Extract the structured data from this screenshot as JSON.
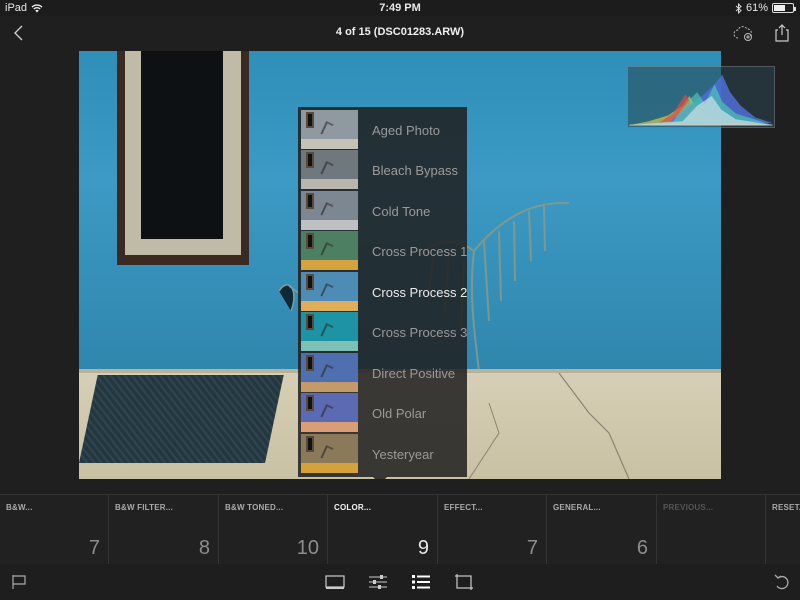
{
  "status_bar": {
    "device": "iPad",
    "time": "7:49 PM",
    "battery": "61%",
    "battery_level": 0.61
  },
  "nav": {
    "title": "4 of 15 (DSC01283.ARW)"
  },
  "presets": [
    {
      "label": "Aged Photo",
      "wall": "#8f9aa0",
      "ground": "#c5c2b8",
      "selected": false
    },
    {
      "label": "Bleach Bypass",
      "wall": "#6f787c",
      "ground": "#b9b6ad",
      "selected": false
    },
    {
      "label": "Cold Tone",
      "wall": "#7d8791",
      "ground": "#bfc0c4",
      "selected": false
    },
    {
      "label": "Cross Process 1",
      "wall": "#4d7f63",
      "ground": "#d6a23f",
      "selected": false
    },
    {
      "label": "Cross Process 2",
      "wall": "#4d8db5",
      "ground": "#e0ae5a",
      "selected": true
    },
    {
      "label": "Cross Process 3",
      "wall": "#1c94a5",
      "ground": "#7fc0b5",
      "selected": false
    },
    {
      "label": "Direct Positive",
      "wall": "#4f6fb0",
      "ground": "#c59a6a",
      "selected": false
    },
    {
      "label": "Old Polar",
      "wall": "#5c6ab4",
      "ground": "#d99d77",
      "selected": false
    },
    {
      "label": "Yesteryear",
      "wall": "#8a7a5a",
      "ground": "#d3a23c",
      "selected": false
    }
  ],
  "groups": [
    {
      "name": "B&W...",
      "count": "7",
      "state": "normal"
    },
    {
      "name": "B&W FILTER...",
      "count": "8",
      "state": "normal"
    },
    {
      "name": "B&W TONED...",
      "count": "10",
      "state": "normal"
    },
    {
      "name": "COLOR...",
      "count": "9",
      "state": "active"
    },
    {
      "name": "EFFECT...",
      "count": "7",
      "state": "normal"
    },
    {
      "name": "GENERAL...",
      "count": "6",
      "state": "normal"
    },
    {
      "name": "PREVIOUS...",
      "count": "",
      "state": "disabled"
    },
    {
      "name": "RESET...",
      "count": "",
      "state": "normal"
    }
  ],
  "icons": {
    "back": "chevron-left-icon",
    "cloud": "cloud-sync-icon",
    "share": "share-icon",
    "flag": "flag-icon",
    "filmstrip": "filmstrip-icon",
    "adjust": "sliders-icon",
    "presets": "presets-list-icon",
    "crop": "crop-icon",
    "undo": "undo-icon"
  },
  "colors": {
    "background": "#1f1f1f",
    "accent_text": "#ececec"
  }
}
